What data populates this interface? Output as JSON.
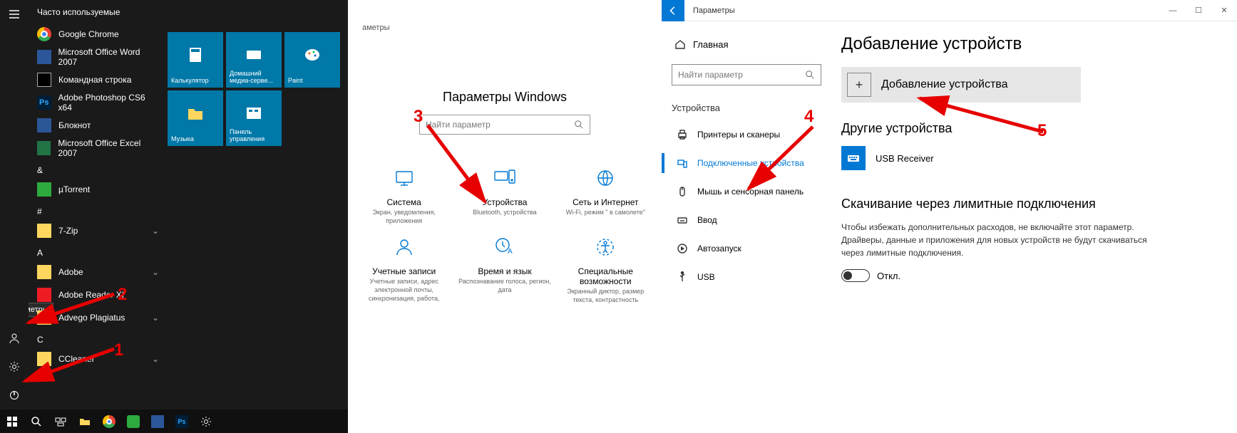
{
  "start_menu": {
    "header": "Часто используемые",
    "rail_tooltip": "Параметры",
    "apps_frequent": [
      {
        "name": "Google Chrome",
        "icon": "chrome"
      },
      {
        "name": "Microsoft Office Word 2007",
        "icon": "word"
      },
      {
        "name": "Командная строка",
        "icon": "cmd"
      },
      {
        "name": "Adobe Photoshop CS6 x64",
        "icon": "ps",
        "label": "Ps"
      },
      {
        "name": "Блокнот",
        "icon": "notepad"
      },
      {
        "name": "Microsoft Office Excel 2007",
        "icon": "excel"
      }
    ],
    "groups": [
      {
        "letter": "&",
        "items": [
          {
            "name": "µTorrent",
            "icon": "utorrent"
          }
        ]
      },
      {
        "letter": "#",
        "items": [
          {
            "name": "7-Zip",
            "icon": "folder",
            "chevron": true
          }
        ]
      },
      {
        "letter": "A",
        "items": [
          {
            "name": "Adobe",
            "icon": "folder",
            "chevron": true
          },
          {
            "name": "Adobe Reader XI",
            "icon": "adobe-reader"
          },
          {
            "name": "Advego Plagiatus",
            "icon": "folder",
            "chevron": true
          }
        ]
      },
      {
        "letter": "C",
        "items": [
          {
            "name": "CCleaner",
            "icon": "ccleaner",
            "chevron": true
          }
        ]
      }
    ],
    "tiles": [
      {
        "label": "Калькулятор",
        "icon": "calc"
      },
      {
        "label": "Домашний медиа-серве...",
        "icon": "media"
      },
      {
        "label": "Paint",
        "icon": "paint"
      },
      {
        "label": "Музыка",
        "icon": "folder"
      },
      {
        "label": "Панель управления",
        "icon": "panel"
      }
    ]
  },
  "settings_main": {
    "breadcrumb": "аметры",
    "title": "Параметры Windows",
    "search_placeholder": "Найти параметр",
    "items": [
      {
        "title": "Система",
        "sub": "Экран, уведомления, приложения",
        "icon": "system"
      },
      {
        "title": "Устройства",
        "sub": "Bluetooth, устройства",
        "icon": "devices"
      },
      {
        "title": "Сеть и Интернет",
        "sub": "Wi-Fi, режим \" в самолете\"",
        "icon": "network"
      },
      {
        "title": "Учетные записи",
        "sub": "Учетные записи, адрес электронной почты, синхронизация, работа,",
        "icon": "accounts"
      },
      {
        "title": "Время и язык",
        "sub": "Распознавание голоса, регион, дата",
        "icon": "time"
      },
      {
        "title": "Специальные возможности",
        "sub": "Экранный диктор, размер текста, контрастность",
        "icon": "ease"
      }
    ]
  },
  "devices_panel": {
    "window_title": "Параметры",
    "home": "Главная",
    "search_placeholder": "Найти параметр",
    "section": "Устройства",
    "nav": [
      {
        "label": "Принтеры и сканеры",
        "icon": "printer"
      },
      {
        "label": "Подключенные устройства",
        "icon": "connected",
        "selected": true
      },
      {
        "label": "Мышь и сенсорная панель",
        "icon": "mouse"
      },
      {
        "label": "Ввод",
        "icon": "keyboard"
      },
      {
        "label": "Автозапуск",
        "icon": "autoplay"
      },
      {
        "label": "USB",
        "icon": "usb"
      }
    ],
    "content": {
      "h1": "Добавление устройств",
      "add_label": "Добавление устройства",
      "h2": "Другие устройства",
      "device_name": "USB Receiver",
      "h2b": "Скачивание через лимитные подключения",
      "para": "Чтобы избежать дополнительных расходов, не включайте этот параметр. Драйверы, данные и приложения для новых устройств не будут скачиваться через лимитные подключения.",
      "toggle_label": "Откл."
    }
  },
  "annotations": {
    "1": "1",
    "2": "2",
    "3": "3",
    "4": "4",
    "5": "5"
  }
}
